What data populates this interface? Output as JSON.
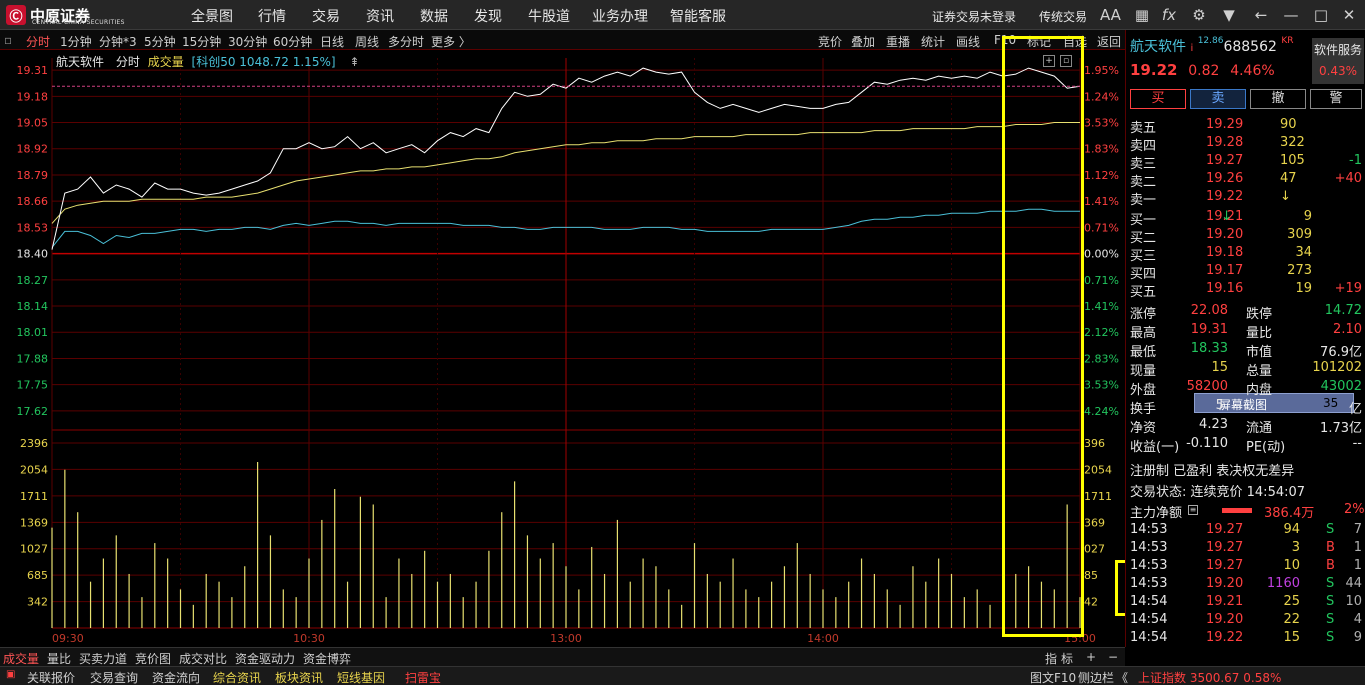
{
  "top": {
    "logo": "中原证券",
    "logo_sub": "CENTRAL CHINA SECURITIES",
    "menu": [
      "全景图",
      "行情",
      "交易",
      "资讯",
      "数据",
      "发现",
      "牛股道",
      "业务办理",
      "智能客服"
    ],
    "login_status": "证券交易未登录",
    "mode": "传统交易",
    "font_btn": "AA",
    "fx": "fx"
  },
  "periods": [
    "分时",
    "1分钟",
    "分钟*3",
    "5分钟",
    "15分钟",
    "30分钟",
    "60分钟",
    "日线",
    "周线",
    "多分时",
    "更多 〉"
  ],
  "chart_tools": [
    "竞价",
    "叠加",
    "重播",
    "统计",
    "画线",
    "F10",
    "标记",
    "自选",
    "返回"
  ],
  "legend": {
    "name": "航天软件",
    "mode": "分时",
    "vol": "成交量",
    "index": "[科创50 1048.72 1.15%]"
  },
  "price_axis": {
    "left": [
      "19.31",
      "19.18",
      "19.05",
      "18.92",
      "18.79",
      "18.66",
      "18.53",
      "18.40",
      "18.27",
      "18.14",
      "18.01",
      "17.88",
      "17.75",
      "17.62"
    ],
    "right": [
      "1.95%",
      "1.24%",
      "3.53%",
      "1.83%",
      "1.12%",
      "1.41%",
      "0.71%",
      "0.00%",
      "0.71%",
      "1.41%",
      "2.12%",
      "2.83%",
      "3.53%",
      "4.24%"
    ]
  },
  "vol_axis": {
    "left": [
      "2396",
      "2054",
      "1711",
      "1369",
      "1027",
      "685",
      "342"
    ],
    "right": [
      "396",
      "2054",
      "1711",
      "369",
      "027",
      "85",
      "42"
    ]
  },
  "time_axis": [
    "09:30",
    "10:30",
    "13:00",
    "14:00",
    "15:00"
  ],
  "chart_data": {
    "type": "line",
    "title": "航天软件 分时",
    "preclose": 18.4,
    "ylim": [
      17.55,
      19.37
    ],
    "vol_ylim": [
      0,
      2500
    ],
    "series": [
      {
        "name": "价格",
        "values": [
          18.42,
          18.7,
          18.72,
          18.78,
          18.7,
          18.74,
          18.72,
          18.68,
          18.75,
          18.72,
          18.72,
          18.7,
          18.69,
          18.7,
          18.72,
          18.74,
          18.76,
          18.8,
          18.92,
          18.92,
          18.95,
          18.92,
          18.93,
          18.98,
          18.92,
          18.95,
          18.9,
          18.92,
          18.94,
          18.9,
          18.96,
          19.0,
          18.98,
          19.02,
          19.0,
          19.12,
          19.2,
          19.18,
          19.19,
          19.24,
          19.22,
          19.27,
          19.25,
          19.28,
          19.3,
          19.28,
          19.32,
          19.3,
          19.29,
          19.3,
          19.2,
          19.15,
          19.12,
          19.14,
          19.12,
          19.1,
          19.12,
          19.14,
          19.13,
          19.12,
          19.12,
          19.14,
          19.15,
          19.2,
          19.25,
          19.24,
          19.26,
          19.27,
          19.26,
          19.28,
          19.27,
          19.28,
          19.27,
          19.3,
          19.28,
          19.29,
          19.32,
          19.3,
          19.28,
          19.22,
          19.23
        ]
      },
      {
        "name": "均价",
        "values": [
          18.55,
          18.62,
          18.64,
          18.65,
          18.66,
          18.66,
          18.66,
          18.67,
          18.67,
          18.67,
          18.67,
          18.67,
          18.68,
          18.68,
          18.68,
          18.69,
          18.7,
          18.72,
          18.74,
          18.76,
          18.77,
          18.78,
          18.79,
          18.8,
          18.81,
          18.81,
          18.82,
          18.82,
          18.83,
          18.83,
          18.84,
          18.85,
          18.86,
          18.87,
          18.87,
          18.88,
          18.9,
          18.91,
          18.92,
          18.93,
          18.94,
          18.94,
          18.95,
          18.95,
          18.96,
          18.96,
          18.96,
          18.97,
          18.97,
          18.97,
          18.98,
          18.98,
          18.98,
          18.98,
          18.99,
          18.99,
          18.99,
          18.99,
          18.99,
          19.0,
          19.0,
          19.0,
          19.0,
          19.0,
          19.01,
          19.01,
          19.01,
          19.02,
          19.02,
          19.02,
          19.02,
          19.02,
          19.03,
          19.03,
          19.03,
          19.04,
          19.04,
          19.04,
          19.05,
          19.05,
          19.05
        ]
      },
      {
        "name": "科创50",
        "values": [
          18.43,
          18.51,
          18.51,
          18.49,
          18.45,
          18.49,
          18.48,
          18.5,
          18.5,
          18.51,
          18.52,
          18.52,
          18.51,
          18.52,
          18.52,
          18.53,
          18.53,
          18.52,
          18.54,
          18.55,
          18.54,
          18.55,
          18.56,
          18.56,
          18.55,
          18.55,
          18.54,
          18.55,
          18.55,
          18.55,
          18.55,
          18.55,
          18.54,
          18.54,
          18.54,
          18.53,
          18.53,
          18.52,
          18.52,
          18.53,
          18.53,
          18.53,
          18.53,
          18.52,
          18.52,
          18.52,
          18.53,
          18.53,
          18.53,
          18.52,
          18.52,
          18.51,
          18.51,
          18.51,
          18.51,
          18.51,
          18.52,
          18.52,
          18.52,
          18.52,
          18.52,
          18.53,
          18.54,
          18.56,
          18.57,
          18.57,
          18.58,
          18.58,
          18.59,
          18.59,
          18.6,
          18.6,
          18.6,
          18.61,
          18.61,
          18.61,
          18.62,
          18.62,
          18.61,
          18.61,
          18.61
        ]
      }
    ],
    "volumes": [
      1300,
      2050,
      1500,
      600,
      900,
      1200,
      700,
      400,
      1100,
      900,
      500,
      300,
      700,
      600,
      400,
      800,
      2150,
      1200,
      500,
      400,
      900,
      1400,
      1800,
      600,
      1700,
      1600,
      400,
      900,
      700,
      1000,
      600,
      700,
      400,
      600,
      1000,
      1500,
      1900,
      1200,
      900,
      1100,
      800,
      500,
      1050,
      700,
      1400,
      600,
      900,
      800,
      500,
      300,
      1100,
      700,
      600,
      900,
      500,
      400,
      600,
      800,
      1100,
      700,
      500,
      400,
      600,
      900,
      700,
      500,
      300,
      800,
      600,
      900,
      700,
      400,
      500,
      300,
      1200,
      700,
      800,
      600,
      500,
      1600,
      400
    ]
  },
  "quote": {
    "name": "航天软件",
    "badge": "i",
    "sub": "12.86",
    "code": "688562",
    "tag": "KR",
    "service": "软件服务",
    "price": "19.22",
    "change": "0.82",
    "pct": "4.46%",
    "sector_pct": "0.43%"
  },
  "btns": [
    "买",
    "卖",
    "撤",
    "警"
  ],
  "asks": [
    {
      "l": "卖五",
      "p": "19.29",
      "v": "90",
      "d": ""
    },
    {
      "l": "卖四",
      "p": "19.28",
      "v": "322",
      "d": ""
    },
    {
      "l": "卖三",
      "p": "19.27",
      "v": "105",
      "d": "-1"
    },
    {
      "l": "卖二",
      "p": "19.26",
      "v": "47",
      "d": "+40"
    },
    {
      "l": "卖一",
      "p": "19.22",
      "v": "↓",
      "d": ""
    }
  ],
  "bids": [
    {
      "l": "买一",
      "p": "19.21",
      "v": "9",
      "d": "↓"
    },
    {
      "l": "买二",
      "p": "19.20",
      "v": "309",
      "d": ""
    },
    {
      "l": "买三",
      "p": "19.18",
      "v": "34",
      "d": ""
    },
    {
      "l": "买四",
      "p": "19.17",
      "v": "273",
      "d": ""
    },
    {
      "l": "买五",
      "p": "19.16",
      "v": "19",
      "d": "+19"
    }
  ],
  "stats": [
    [
      "涨停",
      "22.08",
      "跌停",
      "14.72"
    ],
    [
      "最高",
      "19.31",
      "量比",
      "2.10"
    ],
    [
      "最低",
      "18.33",
      "市值",
      "76.9亿"
    ],
    [
      "现量",
      "15",
      "总量",
      "101202"
    ],
    [
      "外盘",
      "58200",
      "内盘",
      "43002"
    ],
    [
      "换手",
      "5.",
      "",
      "亿"
    ],
    [
      "净资",
      "4.23",
      "流通",
      "1.73亿"
    ],
    [
      "收益(一)",
      "-0.110",
      "PE(动)",
      "--"
    ]
  ],
  "tooltip": "屏幕截图",
  "tooltip_val": "35",
  "tags": "注册制 已盈利 表决权无差异",
  "trade_status": "交易状态: 连续竞价 14:54:07",
  "main_force": {
    "label": "主力净额",
    "value": "386.4万",
    "pct": "2%"
  },
  "ticks": [
    [
      "14:53",
      "19.27",
      "94",
      "S",
      "7"
    ],
    [
      "14:53",
      "19.27",
      "3",
      "B",
      "1"
    ],
    [
      "14:53",
      "19.27",
      "10",
      "B",
      "1"
    ],
    [
      "14:53",
      "19.20",
      "1160",
      "S",
      "44"
    ],
    [
      "14:54",
      "19.21",
      "25",
      "S",
      "10"
    ],
    [
      "14:54",
      "19.20",
      "22",
      "S",
      "4"
    ],
    [
      "14:54",
      "19.22",
      "15",
      "S",
      "9"
    ]
  ],
  "bottom_tabs": [
    "成交量",
    "量比",
    "买卖力道",
    "竞价图",
    "成交对比",
    "资金驱动力",
    "资金博弈"
  ],
  "bottom_right": [
    "指",
    "标",
    "+",
    "−"
  ],
  "status": [
    "关联报价",
    "交易查询",
    "资金流向",
    "综合资讯",
    "板块资讯",
    "短线基因",
    "扫雷宝"
  ],
  "status_right": [
    "图文F10",
    "侧边栏",
    "《"
  ],
  "index_ticker": "上证指数 3500.67 0.58%"
}
